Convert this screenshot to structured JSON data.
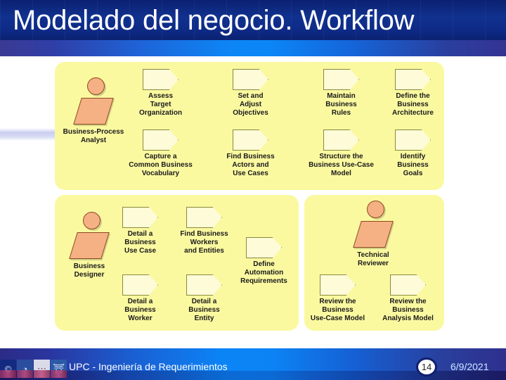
{
  "slide": {
    "title": "Modelado del negocio. Workflow"
  },
  "footer": {
    "text": "UPC - Ingeniería de Requerimientos",
    "slide_number": "14",
    "date": "6/9/2021",
    "thumbnails": [
      {
        "name": "copyright-thumb",
        "glyph": "©"
      },
      {
        "name": "clock-thumb",
        "glyph": "◔"
      },
      {
        "name": "bridge-thumb",
        "glyph": "⋯"
      },
      {
        "name": "dome-thumb",
        "glyph": "⛩"
      }
    ]
  },
  "colors": {
    "panel_fill": "#fbf9a0",
    "activity_fill": "#fdfbd8",
    "activity_border": "#8a8a3c",
    "actor_fill": "#f5b183",
    "actor_border": "#8a4a20",
    "title_bg": "#10318f",
    "band_accent": "#0b85f6"
  },
  "diagram": {
    "panels": [
      {
        "id": "panel-top",
        "name": "business-process-analyst-panel",
        "actor": {
          "name": "business-process-analyst-actor",
          "caption": "Business-Process\nAnalyst"
        },
        "activities": [
          {
            "name": "activity-assess-target-organization",
            "caption": "Assess\nTarget\nOrganization"
          },
          {
            "name": "activity-set-and-adjust-objectives",
            "caption": "Set and\nAdjust\nObjectives"
          },
          {
            "name": "activity-maintain-business-rules",
            "caption": "Maintain\nBusiness\nRules"
          },
          {
            "name": "activity-define-the-business-architecture",
            "caption": "Define the\nBusiness\nArchitecture"
          },
          {
            "name": "activity-capture-a-common-business-vocabulary",
            "caption": "Capture a\nCommon Business\nVocabulary"
          },
          {
            "name": "activity-find-business-actors-and-use-cases",
            "caption": "Find Business\nActors and\nUse Cases"
          },
          {
            "name": "activity-structure-the-business-use-case-model",
            "caption": "Structure the\nBusiness Use-Case\nModel"
          },
          {
            "name": "activity-identify-business-goals",
            "caption": "Identify\nBusiness\nGoals"
          }
        ]
      },
      {
        "id": "panel-designer",
        "name": "business-designer-panel",
        "actor": {
          "name": "business-designer-actor",
          "caption": "Business\nDesigner"
        },
        "activities": [
          {
            "name": "activity-detail-a-business-use-case",
            "caption": "Detail a\nBusiness\nUse Case"
          },
          {
            "name": "activity-find-business-workers-and-entities",
            "caption": "Find Business\nWorkers\nand Entities"
          },
          {
            "name": "activity-define-automation-requirements",
            "caption": "Define\nAutomation\nRequirements"
          },
          {
            "name": "activity-detail-a-business-worker",
            "caption": "Detail a\nBusiness\nWorker"
          },
          {
            "name": "activity-detail-a-business-entity",
            "caption": "Detail a\nBusiness\nEntity"
          }
        ]
      },
      {
        "id": "panel-reviewer",
        "name": "technical-reviewer-panel",
        "actor": {
          "name": "technical-reviewer-actor",
          "caption": "Technical\nReviewer"
        },
        "activities": [
          {
            "name": "activity-review-the-business-use-case-model",
            "caption": "Review the\nBusiness\nUse-Case Model"
          },
          {
            "name": "activity-review-the-business-analysis-model",
            "caption": "Review the\nBusiness\nAnalysis Model"
          }
        ]
      }
    ]
  }
}
